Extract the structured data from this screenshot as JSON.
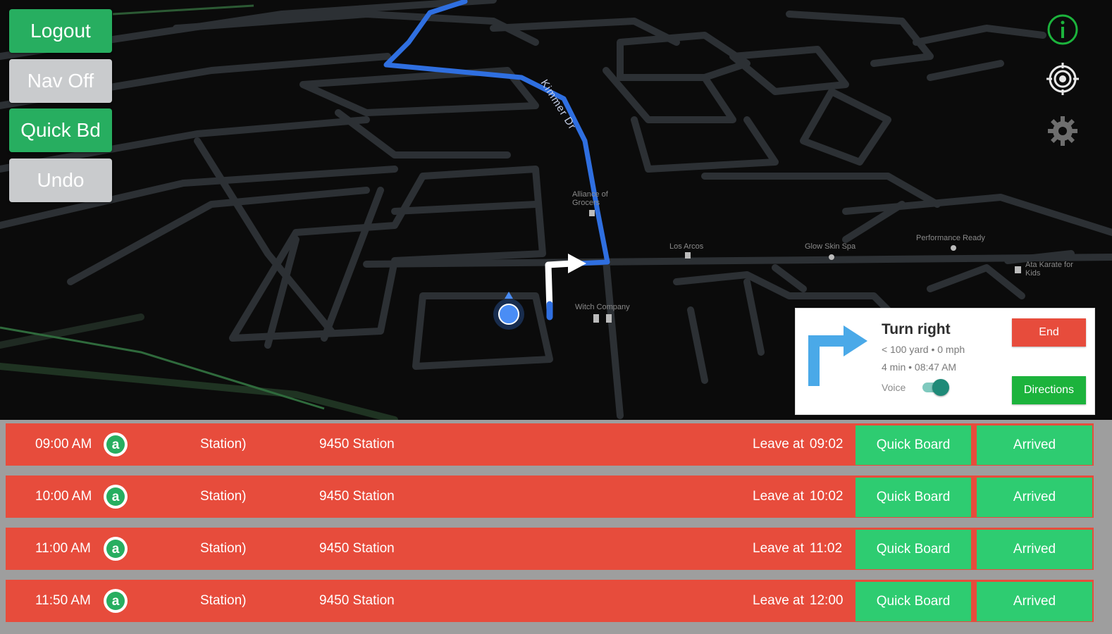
{
  "side_buttons": {
    "logout": "Logout",
    "nav_off": "Nav Off",
    "quick_bd": "Quick Bd",
    "undo": "Undo"
  },
  "map": {
    "street_label": "Kimmer Dr",
    "pois": [
      "Alliance of Grocers",
      "Los Arcos",
      "Glow Skin Spa",
      "Performance Ready",
      "Ata Karate for Kids",
      "Witch Company"
    ],
    "route_color": "#2f6fe0",
    "icons": [
      "info-icon",
      "recenter-target-icon",
      "settings-gear-icon"
    ]
  },
  "navigation": {
    "instruction": "Turn right",
    "distance_speed": "< 100 yard  • 0 mph",
    "eta": "4 min • 08:47 AM",
    "voice_label": "Voice",
    "voice_on": true,
    "end_label": "End",
    "directions_label": "Directions"
  },
  "trips": [
    {
      "time": "09:00 AM",
      "badge": "a",
      "from": "Station)",
      "to": "9450 Station",
      "leave_label": "Leave at",
      "leave_time": "09:02",
      "quick_board": "Quick Board",
      "arrived": "Arrived"
    },
    {
      "time": "10:00 AM",
      "badge": "a",
      "from": "Station)",
      "to": "9450 Station",
      "leave_label": "Leave at",
      "leave_time": "10:02",
      "quick_board": "Quick Board",
      "arrived": "Arrived"
    },
    {
      "time": "11:00 AM",
      "badge": "a",
      "from": "Station)",
      "to": "9450 Station",
      "leave_label": "Leave at",
      "leave_time": "11:02",
      "quick_board": "Quick Board",
      "arrived": "Arrived"
    },
    {
      "time": "11:50 AM",
      "badge": "a",
      "from": "Station)",
      "to": "9450 Station",
      "leave_label": "Leave at",
      "leave_time": "12:00",
      "quick_board": "Quick Board",
      "arrived": "Arrived"
    }
  ],
  "colors": {
    "row_red": "#e74c3c",
    "button_green": "#2ecc71",
    "side_green": "#27ae60",
    "side_gray": "#c9cbcd"
  }
}
